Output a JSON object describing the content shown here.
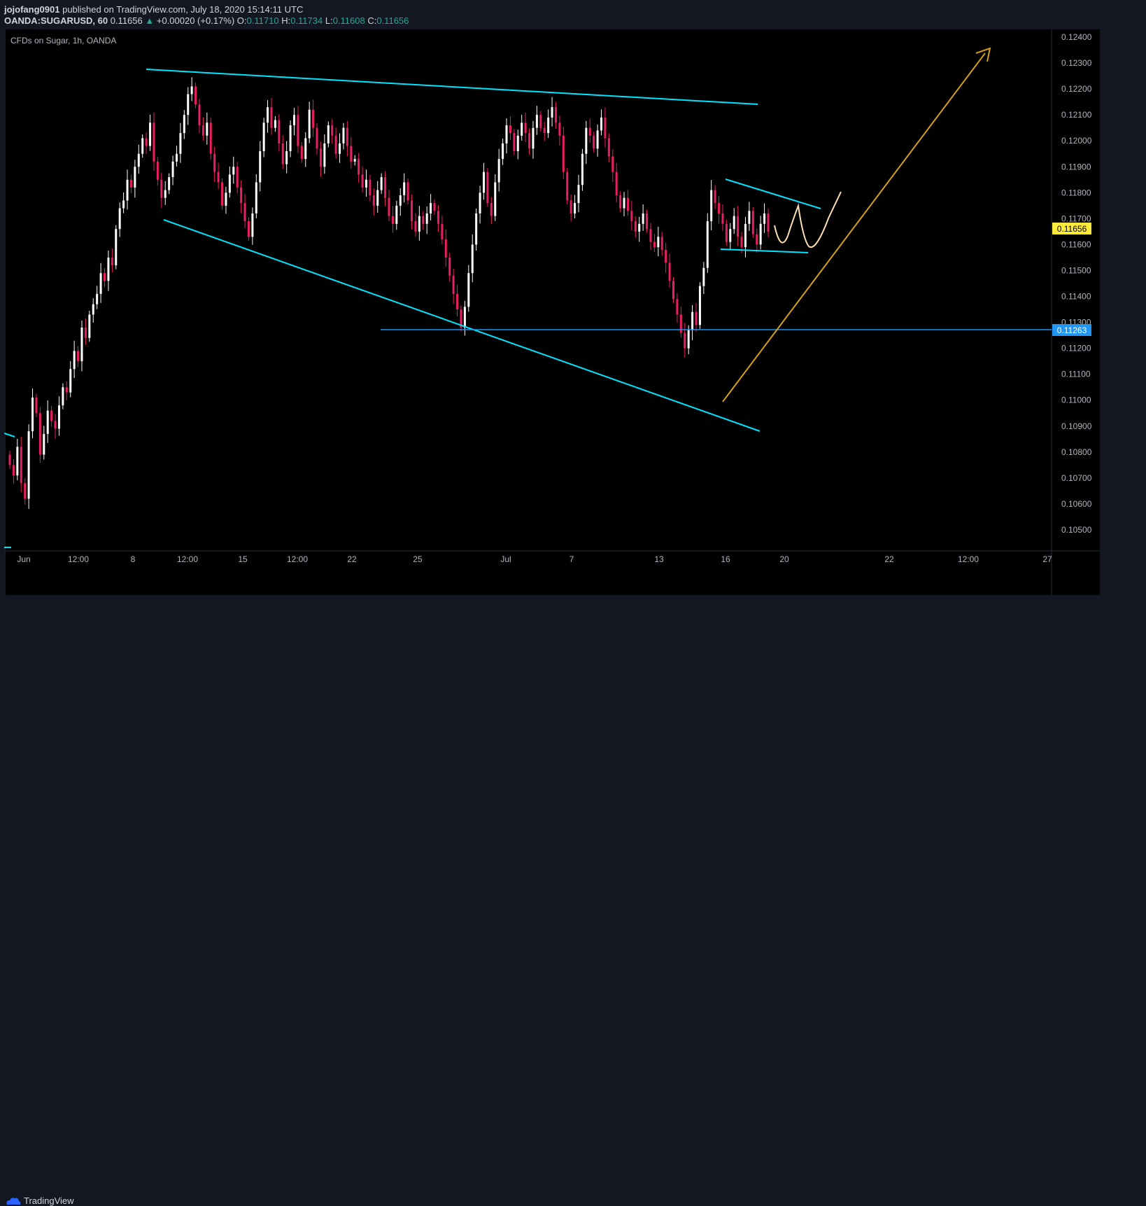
{
  "header": {
    "publisher": "jojofang0901",
    "published_text": "published on TradingView.com, July 18, 2020 15:14:11 UTC",
    "symbol": "OANDA:SUGARUSD, 60",
    "last": "0.11656",
    "change": "+0.00020 (+0.17%)",
    "o_label": "O:",
    "o": "0.11710",
    "h_label": "H:",
    "h": "0.11734",
    "l_label": "L:",
    "l": "0.11608",
    "c_label": "C:",
    "c": "0.11656"
  },
  "chart_title": "CFDs on Sugar, 1h, OANDA",
  "footer": {
    "brand": "TradingView"
  },
  "colors": {
    "background": "#000000",
    "up": "#ffffff",
    "down": "#e91e63",
    "trendline": "#00e5ff",
    "hline": "#2196f3",
    "arrow": "#d4a017",
    "projection": "#ffe0b2",
    "price_tag": "#ffeb3b"
  },
  "chart_data": {
    "type": "candlestick",
    "x_ticks": [
      "Jun",
      "12:00",
      "8",
      "12:00",
      "15",
      "12:00",
      "22",
      "25",
      "Jul",
      "7",
      "13",
      "16",
      "20",
      "22",
      "12:00",
      "27"
    ],
    "y_ticks": [
      "0.12400",
      "0.12300",
      "0.12200",
      "0.12100",
      "0.12000",
      "0.11900",
      "0.11800",
      "0.11700",
      "0.11600",
      "0.11500",
      "0.11400",
      "0.11300",
      "0.11200",
      "0.11100",
      "0.11000",
      "0.10900",
      "0.10800",
      "0.10700",
      "0.10600",
      "0.10500"
    ],
    "ylim": [
      0.1043,
      0.1245
    ],
    "current_price": "0.11656",
    "support_level": "0.11263",
    "closes": [
      0.1075,
      0.1071,
      0.1082,
      0.1068,
      0.1062,
      0.1088,
      0.1101,
      0.1095,
      0.1079,
      0.1087,
      0.1096,
      0.1092,
      0.1089,
      0.1098,
      0.1105,
      0.1103,
      0.1112,
      0.1119,
      0.1115,
      0.1128,
      0.1124,
      0.1133,
      0.1137,
      0.1141,
      0.1149,
      0.1146,
      0.1155,
      0.1152,
      0.1166,
      0.1174,
      0.1177,
      0.1185,
      0.1182,
      0.119,
      0.1195,
      0.1201,
      0.1198,
      0.1207,
      0.1192,
      0.1185,
      0.1178,
      0.1181,
      0.1186,
      0.1192,
      0.1195,
      0.1203,
      0.121,
      0.1218,
      0.1221,
      0.1214,
      0.1206,
      0.1202,
      0.1207,
      0.1195,
      0.1188,
      0.1184,
      0.1175,
      0.118,
      0.1187,
      0.119,
      0.1182,
      0.1176,
      0.1169,
      0.1163,
      0.1172,
      0.1184,
      0.1196,
      0.1207,
      0.1213,
      0.1205,
      0.1208,
      0.1199,
      0.1191,
      0.1196,
      0.1206,
      0.121,
      0.1198,
      0.1193,
      0.1201,
      0.1212,
      0.1205,
      0.1197,
      0.119,
      0.1199,
      0.1206,
      0.1202,
      0.1195,
      0.1199,
      0.1205,
      0.1198,
      0.1192,
      0.1193,
      0.1187,
      0.1182,
      0.1185,
      0.1179,
      0.1175,
      0.1181,
      0.1186,
      0.1178,
      0.1171,
      0.1168,
      0.1175,
      0.1179,
      0.1184,
      0.1177,
      0.1169,
      0.1165,
      0.1171,
      0.1168,
      0.1172,
      0.1176,
      0.1173,
      0.1168,
      0.1162,
      0.1155,
      0.1148,
      0.1141,
      0.1135,
      0.1128,
      0.1136,
      0.1149,
      0.116,
      0.1172,
      0.118,
      0.1188,
      0.1176,
      0.1171,
      0.1184,
      0.1193,
      0.1199,
      0.1206,
      0.1203,
      0.1196,
      0.1202,
      0.1207,
      0.1203,
      0.1197,
      0.1205,
      0.121,
      0.1205,
      0.1203,
      0.1209,
      0.1213,
      0.1207,
      0.1202,
      0.1188,
      0.1177,
      0.1172,
      0.1176,
      0.1183,
      0.1195,
      0.1205,
      0.1202,
      0.1197,
      0.1204,
      0.1209,
      0.1201,
      0.1194,
      0.1188,
      0.1179,
      0.1174,
      0.1178,
      0.1173,
      0.1169,
      0.1165,
      0.1168,
      0.1172,
      0.1166,
      0.1161,
      0.1159,
      0.1163,
      0.1158,
      0.1153,
      0.1146,
      0.1139,
      0.1133,
      0.1126,
      0.112,
      0.1127,
      0.1134,
      0.1129,
      0.1144,
      0.1151,
      0.1169,
      0.1181,
      0.1176,
      0.1172,
      0.1168,
      0.1161,
      0.1166,
      0.1171,
      0.1163,
      0.1159,
      0.1168,
      0.1173,
      0.1164,
      0.116,
      0.1168,
      0.1172,
      0.1165
    ]
  }
}
